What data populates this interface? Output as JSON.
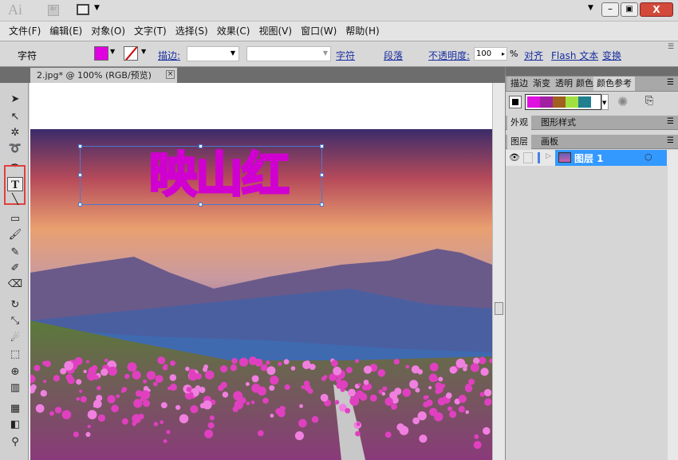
{
  "titlebar": {
    "logo": "Ai",
    "bridge": "Br",
    "icons": [
      "layout-icon",
      "minimize-icon",
      "restore-icon",
      "close-icon"
    ]
  },
  "menu": [
    "文件(F)",
    "编辑(E)",
    "对象(O)",
    "文字(T)",
    "选择(S)",
    "效果(C)",
    "视图(V)",
    "窗口(W)",
    "帮助(H)"
  ],
  "control": {
    "label": "字符",
    "fill_color": "#e000e0",
    "stroke_label": "描边:",
    "char_link": "字符",
    "para_link": "段落",
    "opacity_label": "不透明度:",
    "opacity_value": "100",
    "percent": "%",
    "align": "对齐",
    "flash_text": "Flash 文本",
    "transform": "变换"
  },
  "document": {
    "tab": "2.jpg* @ 100% (RGB/预览)",
    "text": "映山红"
  },
  "panels": {
    "tabs1": [
      "描边",
      "渐变",
      "透明",
      "颜色",
      "颜色参考"
    ],
    "swatches": [
      "#e010e0",
      "#a020a0",
      "#a06020",
      "#a0e040",
      "#208090"
    ],
    "tabs2": [
      "外观",
      "图形样式"
    ],
    "tabs3": [
      "图层",
      "画板"
    ],
    "layer": "图层 1",
    "layer_color": "#3399ff"
  }
}
